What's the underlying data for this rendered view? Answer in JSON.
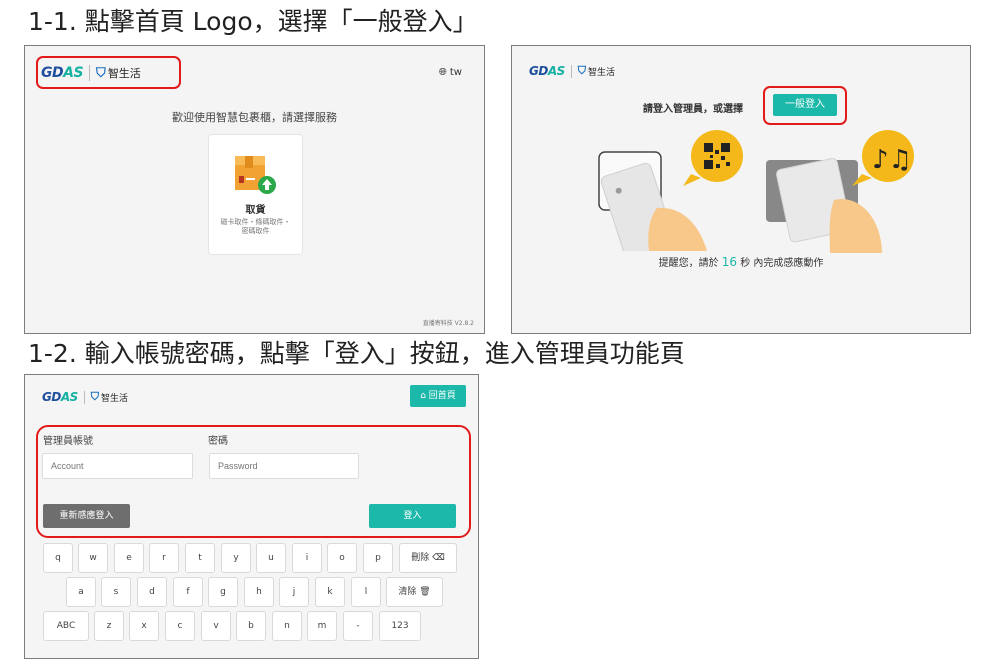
{
  "step1": {
    "heading": "1-1. 點擊首頁 Logo，選擇「一般登入」"
  },
  "step2": {
    "heading": "1-2. 輸入帳號密碼，點擊「登入」按鈕，進入管理員功能頁"
  },
  "brand": {
    "gdas_blue": "GD",
    "gdas_teal": "AS",
    "life": "智生活",
    "accent": "#1cb8a9",
    "highlight": "#e21a1a"
  },
  "home": {
    "language": "tw",
    "welcome": "歡迎使用智慧包裹櫃，請選擇服務",
    "pickup_title": "取貨",
    "pickup_desc_1": "磁卡取件・條碼取件・",
    "pickup_desc_2": "密碼取件",
    "version": "直播寄科技 V2.8.2"
  },
  "admin_prompt": {
    "prompt": "請登入管理員，或選擇",
    "general_login": "一般登入",
    "reminder_prefix": "提醒您，請於",
    "seconds": "16",
    "reminder_suffix": "秒 內完成感應動作"
  },
  "login": {
    "home_button": "回首頁",
    "account_label": "管理員帳號",
    "password_label": "密碼",
    "account_placeholder": "Account",
    "password_placeholder": "Password",
    "resense_button": "重新感應登入",
    "login_button": "登入"
  },
  "keyboard": {
    "row1": [
      "q",
      "w",
      "e",
      "r",
      "t",
      "y",
      "u",
      "i",
      "o",
      "p"
    ],
    "delete": "刪除",
    "row2": [
      "a",
      "s",
      "d",
      "f",
      "g",
      "h",
      "j",
      "k",
      "l"
    ],
    "clear": "清除",
    "row3": [
      "ABC",
      "z",
      "x",
      "c",
      "v",
      "b",
      "n",
      "m",
      "-",
      "123"
    ]
  }
}
